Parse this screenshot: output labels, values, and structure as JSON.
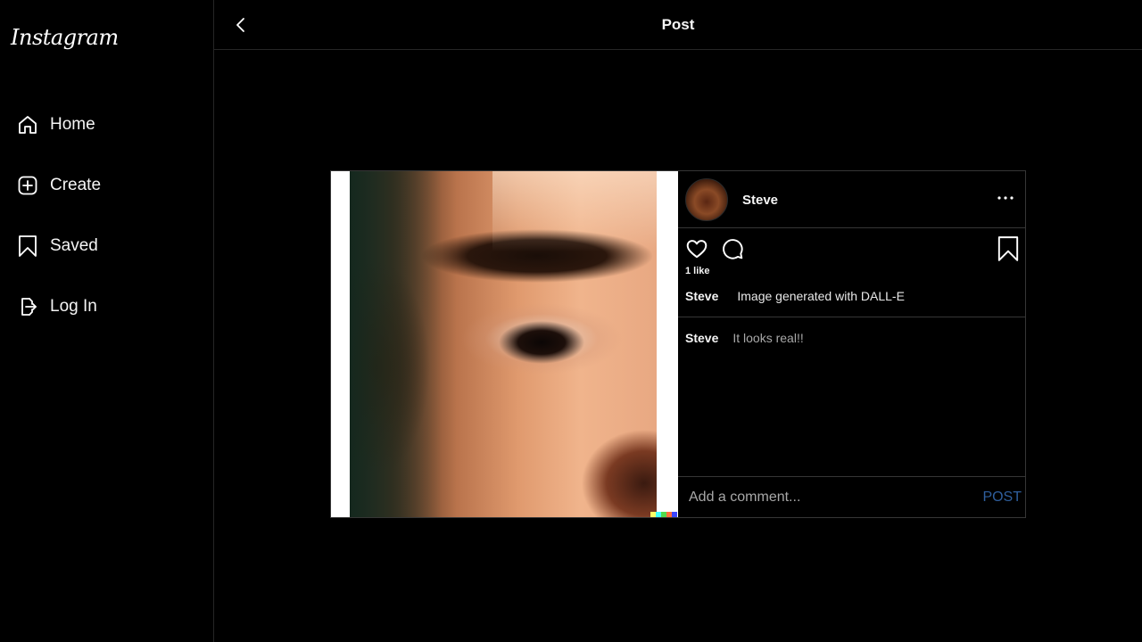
{
  "app": {
    "logo_text": "Instagram"
  },
  "sidebar": {
    "items": [
      {
        "label": "Home",
        "icon": "home-icon"
      },
      {
        "label": "Create",
        "icon": "plus-square-icon"
      },
      {
        "label": "Saved",
        "icon": "bookmark-icon"
      },
      {
        "label": "Log In",
        "icon": "login-icon"
      }
    ]
  },
  "header": {
    "title": "Post",
    "back_icon": "chevron-left-icon"
  },
  "post": {
    "author": "Steve",
    "likes_text": "1 like",
    "caption_user": "Steve",
    "caption_text": "Image generated with DALL-E",
    "comments": [
      {
        "user": "Steve",
        "text": "It looks real!!"
      }
    ],
    "comment_placeholder": "Add a comment...",
    "post_button": "POST",
    "icons": [
      "heart-icon",
      "comment-icon",
      "bookmark-icon",
      "more-icon"
    ],
    "dalle_colors": [
      "#ffff66",
      "#42ffff",
      "#51da4c",
      "#ff6e3c",
      "#3c46ff"
    ]
  },
  "colors": {
    "background": "#000000",
    "border": "#363636",
    "post_button": "#2f5f9e"
  }
}
